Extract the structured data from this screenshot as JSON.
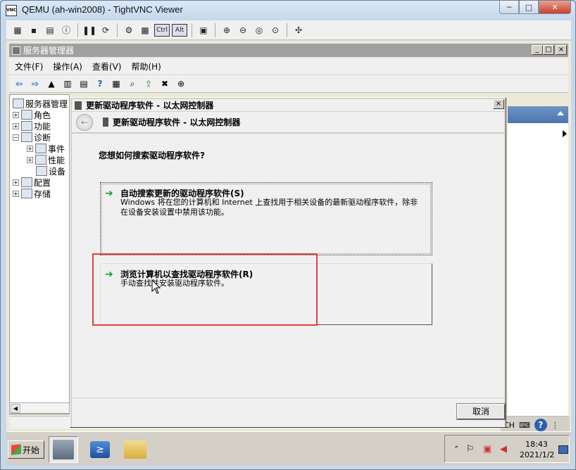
{
  "vnc": {
    "app_icon_text": "VNC",
    "title": "QEMU (ah-win2008) - TightVNC Viewer",
    "controls": {
      "minimize": "─",
      "maximize": "□",
      "close": "✕"
    },
    "toolbar": {
      "ctrl_label": "Ctrl",
      "alt_label": "Alt"
    }
  },
  "server_manager": {
    "title": "服务器管理器",
    "menu": [
      "文件(F)",
      "操作(A)",
      "查看(V)",
      "帮助(H)"
    ],
    "tree": [
      {
        "label": "服务器管理",
        "expander": "",
        "indent": 0
      },
      {
        "label": "角色",
        "expander": "+",
        "indent": 1
      },
      {
        "label": "功能",
        "expander": "+",
        "indent": 1
      },
      {
        "label": "诊断",
        "expander": "−",
        "indent": 1
      },
      {
        "label": "事件",
        "expander": "+",
        "indent": 2
      },
      {
        "label": "性能",
        "expander": "+",
        "indent": 2
      },
      {
        "label": "设备",
        "expander": "",
        "indent": 2
      },
      {
        "label": "配置",
        "expander": "+",
        "indent": 1
      },
      {
        "label": "存储",
        "expander": "+",
        "indent": 1
      }
    ]
  },
  "dialog": {
    "title": "更新驱动程序软件 - 以太网控制器",
    "header": "更新驱动程序软件 - 以太网控制器",
    "question": "您想如何搜索驱动程序软件?",
    "option_auto": {
      "title": "自动搜索更新的驱动程序软件(S)",
      "description": "Windows 将在您的计算机和 Internet 上查找用于相关设备的最新驱动程序软件，除非在设备安装设置中禁用该功能。"
    },
    "option_browse": {
      "title": "浏览计算机以查找驱动程序软件(R)",
      "description": "手动查找并安装驱动程序软件。"
    },
    "cancel_label": "取消"
  },
  "taskbar": {
    "start_label": "开始",
    "clock_time": "18:43",
    "clock_date": "2021/1/2",
    "language": "CH"
  },
  "colors": {
    "highlight_box": "#e04040",
    "option_arrow": "#1e9a2e"
  }
}
